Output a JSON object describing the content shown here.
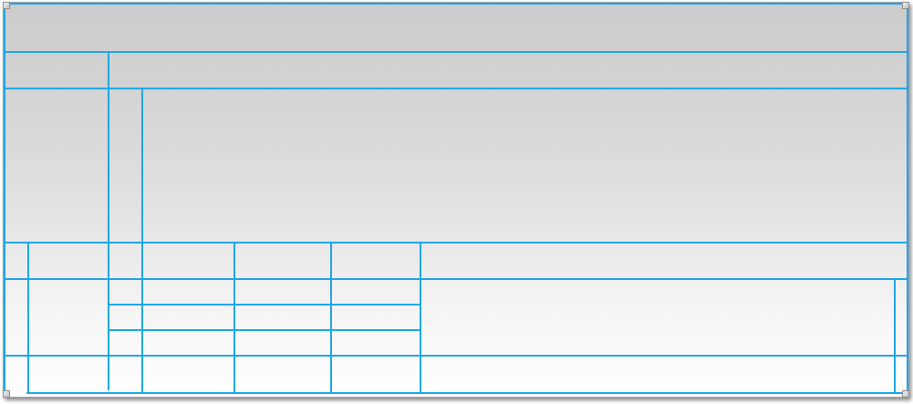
{
  "window": {
    "title": "",
    "colors": {
      "grid_line": "#1ea7e6",
      "frame_border": "#9aa3ab",
      "gradient_top": "#cfcfcf",
      "gradient_bottom": "#ffffff"
    }
  },
  "grid": {
    "header_row": {
      "label": "",
      "value": ""
    },
    "description": {
      "label": "",
      "value": ""
    },
    "columns": [
      {
        "header": ""
      },
      {
        "header": ""
      },
      {
        "header": ""
      },
      {
        "header": ""
      },
      {
        "header": ""
      },
      {
        "header": ""
      },
      {
        "header": ""
      }
    ],
    "rows": [
      {
        "cells": [
          "",
          "",
          "",
          "",
          ""
        ]
      },
      {
        "cells": [
          "",
          "",
          "",
          "",
          ""
        ]
      },
      {
        "cells": [
          "",
          "",
          "",
          "",
          ""
        ]
      }
    ],
    "footer": {
      "cells": [
        "",
        "",
        "",
        "",
        "",
        ""
      ]
    }
  }
}
